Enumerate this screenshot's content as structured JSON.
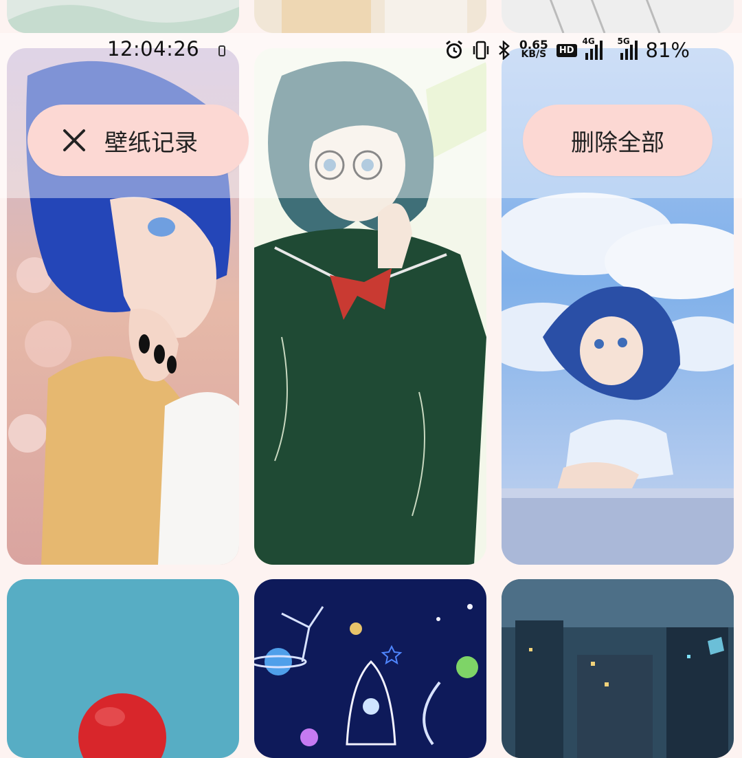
{
  "status_bar": {
    "time": "12:04:26",
    "net_speed_value": "0.65",
    "net_speed_unit": "KB/S",
    "hd_badge": "HD",
    "signal_1_label": "4G",
    "signal_2_label": "5G",
    "battery": "81%"
  },
  "header": {
    "title": "壁纸记录",
    "delete_all_label": "删除全部"
  },
  "wallpapers": [
    {
      "icon": "anime-girl-blue-hair-wallpaper"
    },
    {
      "icon": "anime-girl-sailor-uniform-wallpaper"
    },
    {
      "icon": "anime-girl-sky-clouds-wallpaper"
    },
    {
      "icon": "red-ball-teal-wallpaper"
    },
    {
      "icon": "space-rocket-planets-wallpaper"
    },
    {
      "icon": "night-city-aerial-wallpaper"
    }
  ],
  "colors": {
    "background": "#fdf3f1",
    "pill": "#fcd8d3"
  }
}
